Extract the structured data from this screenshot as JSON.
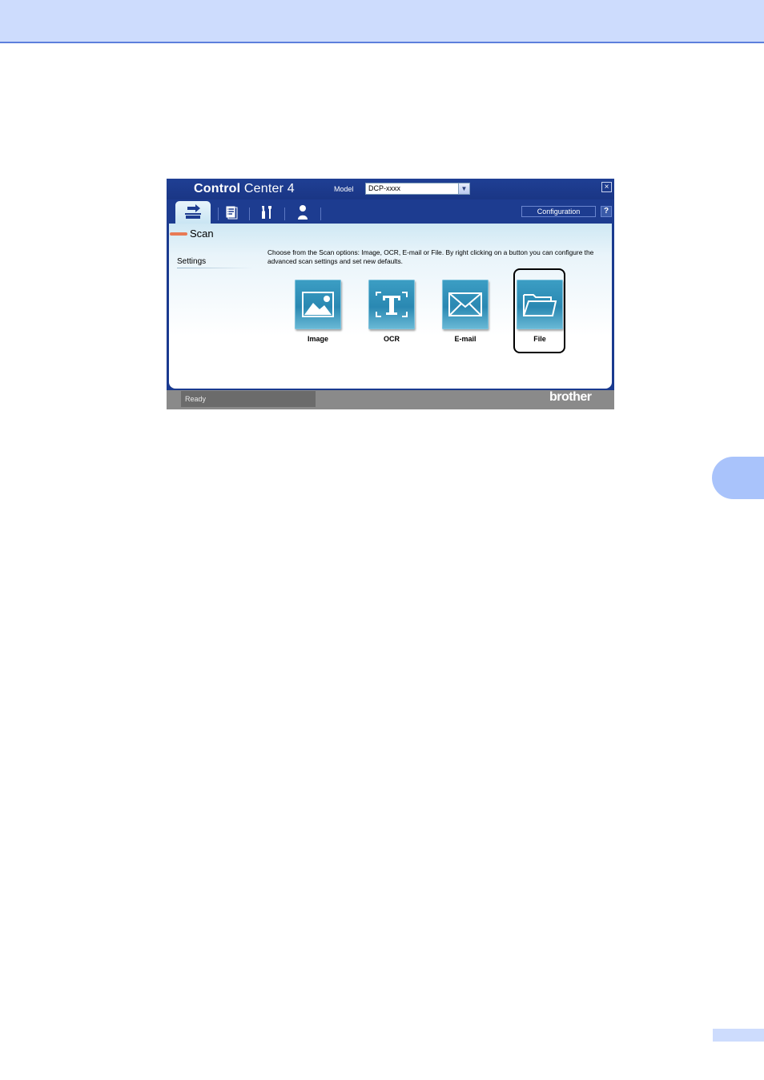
{
  "app": {
    "title_bold": "Control",
    "title_rest": " Center 4",
    "model_label": "Model",
    "model_value": "DCP-xxxx",
    "close_label": "×",
    "configuration_label": "Configuration",
    "help_label": "?"
  },
  "tabs": [
    {
      "icon": "scan-icon",
      "active": true
    },
    {
      "icon": "document-icon",
      "active": false
    },
    {
      "icon": "tools-icon",
      "active": false
    },
    {
      "icon": "person-icon",
      "active": false
    }
  ],
  "section": {
    "title": "Scan",
    "settings": "Settings",
    "description": "Choose from the Scan options: Image, OCR, E-mail or File. By right clicking on a button you can configure the advanced scan settings and set new defaults."
  },
  "actions": [
    {
      "label": "Image",
      "icon": "image-icon"
    },
    {
      "label": "OCR",
      "icon": "ocr-icon"
    },
    {
      "label": "E-mail",
      "icon": "envelope-icon"
    },
    {
      "label": "File",
      "icon": "folder-icon"
    }
  ],
  "status": {
    "text": "Ready",
    "brand": "brother"
  },
  "colors": {
    "top_band": "#cddcfd",
    "window_frame": "#1a3a8f",
    "button_blue": "#2a88b2",
    "accent_orange": "#e87a55"
  }
}
